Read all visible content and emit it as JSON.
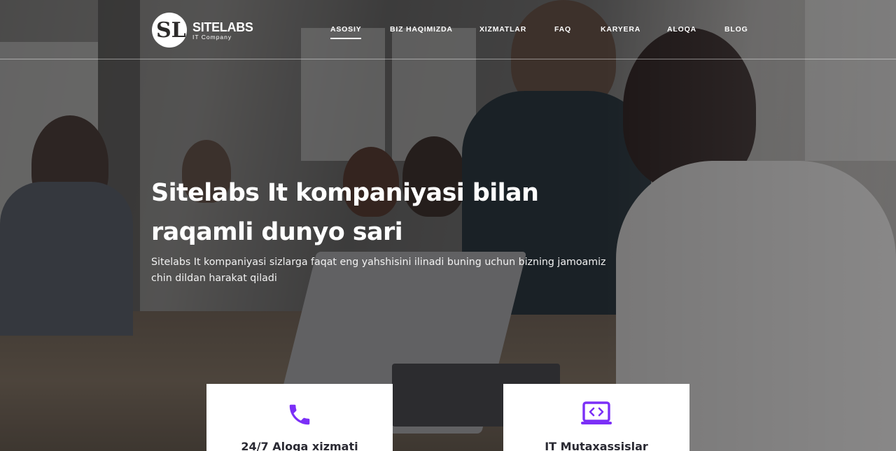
{
  "brand": {
    "name": "SITELABS",
    "tagline": "IT Company",
    "monogram": "SL"
  },
  "nav": {
    "items": [
      {
        "label": "ASOSIY",
        "active": true
      },
      {
        "label": "BIZ HAQIMIZDA",
        "active": false
      },
      {
        "label": "XIZMATLAR",
        "active": false
      },
      {
        "label": "FAQ",
        "active": false
      },
      {
        "label": "KARYERA",
        "active": false
      },
      {
        "label": "ALOQA",
        "active": false
      },
      {
        "label": "BLOG",
        "active": false
      }
    ]
  },
  "hero": {
    "title_line1": "Sitelabs It kompaniyasi bilan",
    "title_line2": "raqamli dunyo sari",
    "description": "Sitelabs It kompaniyasi sizlarga faqat eng yahshisini ilinadi buning uchun bizning jamoamiz chin dildan harakat qiladi"
  },
  "features": [
    {
      "title": "24/7 Aloqa xizmati",
      "icon": "phone-icon"
    },
    {
      "title": "IT Mutaxassislar",
      "icon": "laptop-code-icon"
    }
  ],
  "colors": {
    "accent": "#7b2ff7",
    "overlay": "#121216",
    "card_bg": "#ffffff",
    "card_text": "#2a2a33"
  }
}
